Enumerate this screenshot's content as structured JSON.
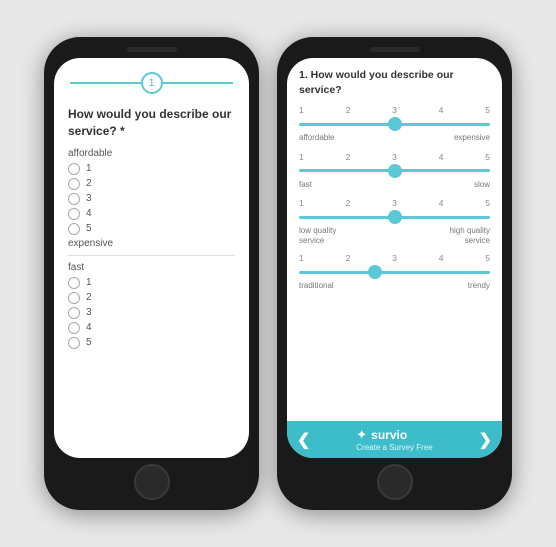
{
  "leftPhone": {
    "progressStep": "1",
    "questionTitle": "How would you describe our service? *",
    "scales": [
      {
        "label": "affordable",
        "options": [
          "1",
          "2",
          "3",
          "4",
          "5"
        ]
      },
      {
        "label": "expensive",
        "options": []
      },
      {
        "label": "fast",
        "options": [
          "1",
          "2",
          "3",
          "4",
          "5"
        ]
      }
    ]
  },
  "rightPhone": {
    "questionTitle": "1. How would you describe our service?",
    "sliders": [
      {
        "numbers": [
          "1",
          "2",
          "3",
          "4",
          "5"
        ],
        "thumbPercent": 50,
        "labelLeft": "affordable",
        "labelRight": "expensive"
      },
      {
        "numbers": [
          "1",
          "2",
          "3",
          "4",
          "5"
        ],
        "thumbPercent": 50,
        "labelLeft": "fast",
        "labelRight": "slow"
      },
      {
        "numbers": [
          "1",
          "2",
          "3",
          "4",
          "5"
        ],
        "thumbPercent": 50,
        "labelLeft": "low quality\nservice",
        "labelRight": "high quality\nservice"
      },
      {
        "numbers": [
          "1",
          "2",
          "3",
          "4",
          "5"
        ],
        "thumbPercent": 40,
        "labelLeft": "traditional",
        "labelRight": "trendy"
      }
    ],
    "bottomBar": {
      "prevArrow": "❮",
      "nextArrow": "❯",
      "brandIcon": "✦",
      "brandName": "survio",
      "brandSub": "Create a Survey Free"
    }
  }
}
